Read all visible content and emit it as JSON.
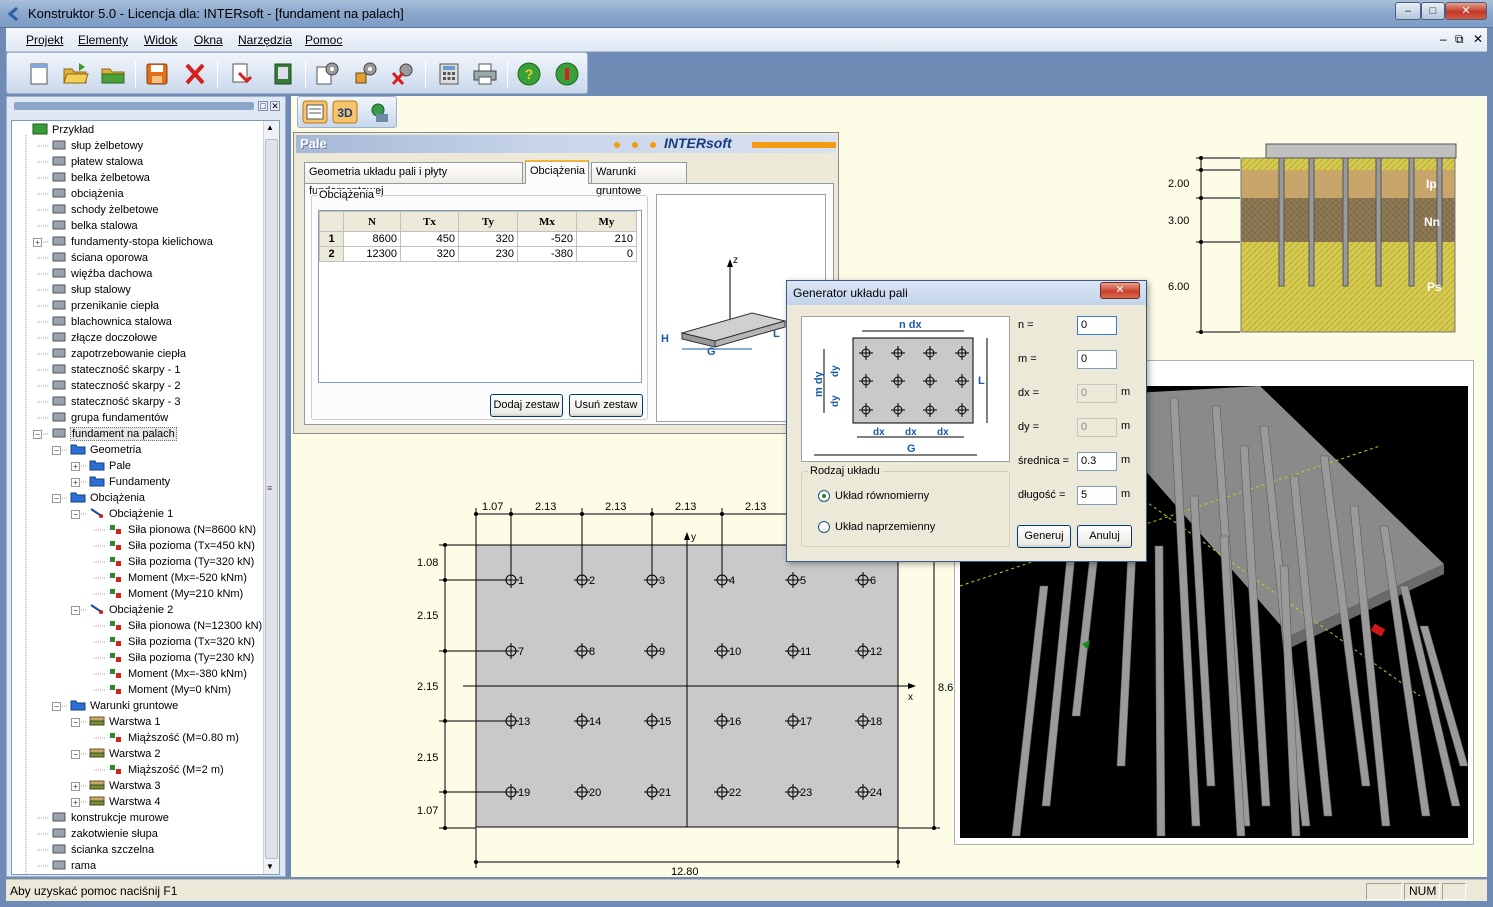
{
  "window": {
    "title": "Konstruktor 5.0 - Licencja dla: INTERsoft - [fundament na palach]"
  },
  "menu": [
    "Projekt",
    "Elementy",
    "Widok",
    "Okna",
    "Narzędzia",
    "Pomoc"
  ],
  "toolbar_icons": [
    "new-file-icon",
    "open-folder-icon",
    "folder-icon",
    "save-icon",
    "delete-icon",
    "export-icon",
    "import-icon",
    "settings-gear-icon",
    "settings-tools-icon",
    "settings-remove-icon",
    "calculator-icon",
    "print-icon",
    "help-icon",
    "info-icon"
  ],
  "toolbar2_icons": [
    "view-2d-icon",
    "view-3d-icon",
    "model-settings-icon"
  ],
  "tree": [
    {
      "label": "Przykład",
      "level": 0,
      "icon": "project-icon"
    },
    {
      "label": "słup żelbetowy",
      "level": 1,
      "icon": "element-icon"
    },
    {
      "label": "płatew stalowa",
      "level": 1,
      "icon": "element-icon"
    },
    {
      "label": "belka żelbetowa",
      "level": 1,
      "icon": "element-icon"
    },
    {
      "label": "obciążenia",
      "level": 1,
      "icon": "element-icon"
    },
    {
      "label": "schody żelbetowe",
      "level": 1,
      "icon": "element-icon"
    },
    {
      "label": "belka stalowa",
      "level": 1,
      "icon": "element-icon"
    },
    {
      "label": "fundamenty-stopa kielichowa",
      "level": 1,
      "icon": "element-icon",
      "exp": "+"
    },
    {
      "label": "ściana oporowa",
      "level": 1,
      "icon": "element-icon"
    },
    {
      "label": "więźba dachowa",
      "level": 1,
      "icon": "element-icon"
    },
    {
      "label": "słup stalowy",
      "level": 1,
      "icon": "element-icon"
    },
    {
      "label": "przenikanie ciepła",
      "level": 1,
      "icon": "element-icon"
    },
    {
      "label": "blachownica stalowa",
      "level": 1,
      "icon": "element-icon"
    },
    {
      "label": "złącze doczołowe",
      "level": 1,
      "icon": "element-icon"
    },
    {
      "label": "zapotrzebowanie ciepła",
      "level": 1,
      "icon": "element-icon"
    },
    {
      "label": "stateczność skarpy - 1",
      "level": 1,
      "icon": "element-icon"
    },
    {
      "label": "stateczność skarpy - 2",
      "level": 1,
      "icon": "element-icon"
    },
    {
      "label": "stateczność skarpy - 3",
      "level": 1,
      "icon": "element-icon"
    },
    {
      "label": "grupa fundamentów",
      "level": 1,
      "icon": "element-icon"
    },
    {
      "label": "fundament na palach",
      "level": 1,
      "icon": "element-icon",
      "exp": "-",
      "selected": true
    },
    {
      "label": "Geometria",
      "level": 2,
      "icon": "folder-icon",
      "exp": "-"
    },
    {
      "label": "Pale",
      "level": 3,
      "icon": "folder-icon",
      "exp": "+"
    },
    {
      "label": "Fundamenty",
      "level": 3,
      "icon": "folder-icon",
      "exp": "+"
    },
    {
      "label": "Obciążenia",
      "level": 2,
      "icon": "folder-icon",
      "exp": "-"
    },
    {
      "label": "Obciążenie 1",
      "level": 3,
      "icon": "load-icon",
      "exp": "-"
    },
    {
      "label": "Siła pionowa (N=8600 kN)",
      "level": 4,
      "icon": "item-icon"
    },
    {
      "label": "Siła pozioma (Tx=450 kN)",
      "level": 4,
      "icon": "item-icon"
    },
    {
      "label": "Siła pozioma (Ty=320 kN)",
      "level": 4,
      "icon": "item-icon"
    },
    {
      "label": "Moment (Mx=-520 kNm)",
      "level": 4,
      "icon": "item-icon"
    },
    {
      "label": "Moment (My=210 kNm)",
      "level": 4,
      "icon": "item-icon"
    },
    {
      "label": "Obciążenie 2",
      "level": 3,
      "icon": "load-icon",
      "exp": "-"
    },
    {
      "label": "Siła pionowa (N=12300 kN)",
      "level": 4,
      "icon": "item-icon"
    },
    {
      "label": "Siła pozioma (Tx=320 kN)",
      "level": 4,
      "icon": "item-icon"
    },
    {
      "label": "Siła pozioma (Ty=230 kN)",
      "level": 4,
      "icon": "item-icon"
    },
    {
      "label": "Moment (Mx=-380 kNm)",
      "level": 4,
      "icon": "item-icon"
    },
    {
      "label": "Moment (My=0 kNm)",
      "level": 4,
      "icon": "item-icon"
    },
    {
      "label": "Warunki gruntowe",
      "level": 2,
      "icon": "folder-icon",
      "exp": "-"
    },
    {
      "label": "Warstwa 1",
      "level": 3,
      "icon": "soil-icon",
      "exp": "-"
    },
    {
      "label": "Miąższość (M=0.80 m)",
      "level": 4,
      "icon": "item-icon"
    },
    {
      "label": "Warstwa 2",
      "level": 3,
      "icon": "soil-icon",
      "exp": "-"
    },
    {
      "label": "Miąższość (M=2 m)",
      "level": 4,
      "icon": "item-icon"
    },
    {
      "label": "Warstwa 3",
      "level": 3,
      "icon": "soil-icon",
      "exp": "+"
    },
    {
      "label": "Warstwa 4",
      "level": 3,
      "icon": "soil-icon",
      "exp": "+"
    },
    {
      "label": "konstrukcje murowe",
      "level": 1,
      "icon": "element-icon"
    },
    {
      "label": "zakotwienie słupa",
      "level": 1,
      "icon": "element-icon"
    },
    {
      "label": "ścianka szczelna",
      "level": 1,
      "icon": "element-icon"
    },
    {
      "label": "rama",
      "level": 1,
      "icon": "element-icon"
    }
  ],
  "pale": {
    "title": "Pale",
    "brand": "INTERsoft",
    "tabs": [
      "Geometria układu pali i płyty fundamentowej",
      "Obciążenia",
      "Warunki gruntowe"
    ],
    "group_label": "Obciążenia",
    "columns": [
      "",
      "N",
      "Tx",
      "Ty",
      "Mx",
      "My"
    ],
    "rows": [
      [
        "1",
        "8600",
        "450",
        "320",
        "-520",
        "210"
      ],
      [
        "2",
        "12300",
        "320",
        "230",
        "-380",
        "0"
      ]
    ],
    "add_button": "Dodaj zestaw",
    "remove_button": "Usuń zestaw",
    "preview_labels": {
      "z": "z",
      "h": "H",
      "g": "G",
      "l": "L"
    }
  },
  "soil_profile": {
    "depths": [
      "2.00",
      "3.00",
      "6.00"
    ],
    "layers": [
      "Ip",
      "Nn",
      "Ps"
    ]
  },
  "plan": {
    "top_dims": [
      "1.07",
      "2.13",
      "2.13",
      "2.13",
      "2.13"
    ],
    "left_dims": [
      "1.08",
      "2.15",
      "2.15",
      "2.15",
      "1.07"
    ],
    "bottom_dim": "12.80",
    "right_dim": "8.6",
    "axis_x": "x",
    "axis_y": "y",
    "piles": [
      "1",
      "2",
      "3",
      "4",
      "5",
      "6",
      "7",
      "8",
      "9",
      "10",
      "11",
      "12",
      "13",
      "14",
      "15",
      "16",
      "17",
      "18",
      "19",
      "20",
      "21",
      "22",
      "23",
      "24"
    ]
  },
  "dialog": {
    "title": "Generator układu pali",
    "pic_labels": {
      "ndx": "n dx",
      "mdy": "m dy",
      "dy": "dy",
      "dx": "dx",
      "g": "G",
      "l": "L"
    },
    "fields": [
      {
        "label": "n =",
        "value": "0",
        "unit": "",
        "disabled": false
      },
      {
        "label": "m =",
        "value": "0",
        "unit": "",
        "disabled": false
      },
      {
        "label": "dx =",
        "value": "0",
        "unit": "m",
        "disabled": true
      },
      {
        "label": "dy =",
        "value": "0",
        "unit": "m",
        "disabled": true
      },
      {
        "label": "średnica =",
        "value": "0.3",
        "unit": "m",
        "disabled": false
      },
      {
        "label": "długość =",
        "value": "5",
        "unit": "m",
        "disabled": false
      }
    ],
    "group_label": "Rodzaj układu",
    "options": [
      "Układ równomierny",
      "Układ naprzemienny"
    ],
    "generate": "Generuj",
    "cancel": "Anuluj"
  },
  "status": {
    "hint": "Aby uzyskać pomoc naciśnij F1",
    "num": "NUM"
  },
  "colors": {
    "accent": "#f39c12",
    "brand": "#1a3d7c",
    "soil1": "#c8a66b",
    "soil2": "#8d7a55",
    "soil3": "#d6cb4e"
  }
}
